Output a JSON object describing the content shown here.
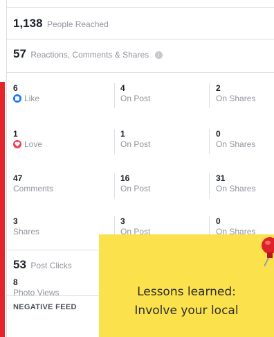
{
  "summary": {
    "reached": {
      "value": "1,138",
      "label": "People Reached"
    },
    "reactions": {
      "value": "57",
      "label": "Reactions, Comments & Shares",
      "info_icon": "info-icon"
    }
  },
  "breakdown": {
    "rows": [
      {
        "kind": "like",
        "icon": "like-icon",
        "c1_value": "6",
        "c1_label": "Like",
        "c2_value": "4",
        "c2_label": "On Post",
        "c3_value": "2",
        "c3_label": "On Shares"
      },
      {
        "kind": "love",
        "icon": "love-icon",
        "c1_value": "1",
        "c1_label": "Love",
        "c2_value": "1",
        "c2_label": "On Post",
        "c3_value": "0",
        "c3_label": "On Shares"
      },
      {
        "kind": "comments",
        "icon": "",
        "c1_value": "47",
        "c1_label": "Comments",
        "c2_value": "16",
        "c2_label": "On Post",
        "c3_value": "31",
        "c3_label": "On Shares"
      },
      {
        "kind": "shares",
        "icon": "",
        "c1_value": "3",
        "c1_label": "Shares",
        "c2_value": "3",
        "c2_label": "On Post",
        "c3_value": "0",
        "c3_label": "On Shares"
      }
    ]
  },
  "clicks": {
    "value": "53",
    "label": "Post Clicks"
  },
  "photo_views": {
    "value": "8",
    "label": "Photo Views"
  },
  "negative_feedback": {
    "label": "NEGATIVE FEED"
  },
  "note": {
    "line1": "Lessons learned:",
    "line2": "Involve your local"
  },
  "colors": {
    "like": "#1877f2",
    "love": "#f33e58",
    "note": "#fbe24c",
    "stripe": "#e3242b",
    "pin": "#e0202a"
  }
}
